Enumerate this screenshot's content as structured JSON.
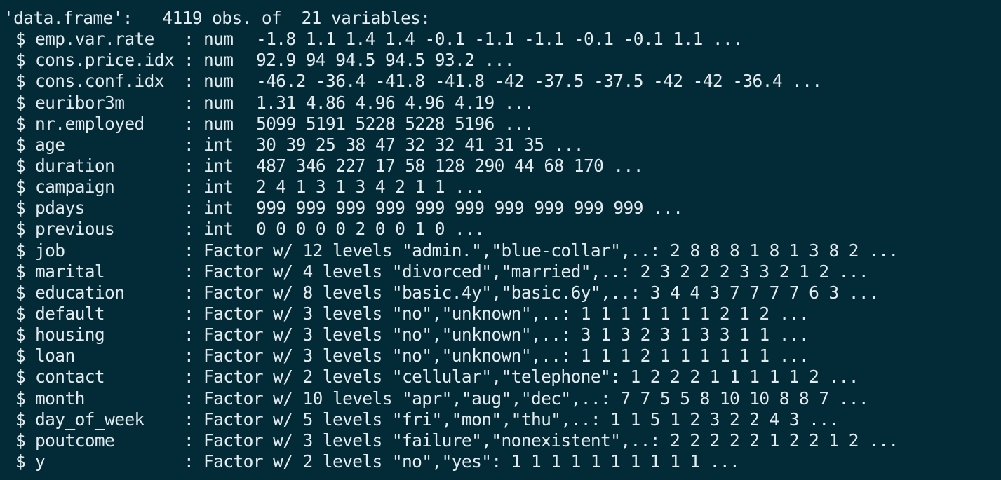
{
  "console": {
    "header": "'data.frame':   4119 obs. of  21 variables:",
    "bullet": "$",
    "colon": ":",
    "rows": [
      {
        "name": "emp.var.rate",
        "type": "num",
        "values": "-1.8 1.1 1.4 1.4 -0.1 -1.1 -1.1 -0.1 -0.1 1.1 ..."
      },
      {
        "name": "cons.price.idx",
        "type": "num",
        "values": "92.9 94 94.5 94.5 93.2 ..."
      },
      {
        "name": "cons.conf.idx",
        "type": "num",
        "values": "-46.2 -36.4 -41.8 -41.8 -42 -37.5 -37.5 -42 -42 -36.4 ..."
      },
      {
        "name": "euribor3m",
        "type": "num",
        "values": "1.31 4.86 4.96 4.96 4.19 ..."
      },
      {
        "name": "nr.employed",
        "type": "num",
        "values": "5099 5191 5228 5228 5196 ..."
      },
      {
        "name": "age",
        "type": "int",
        "values": "30 39 25 38 47 32 32 41 31 35 ..."
      },
      {
        "name": "duration",
        "type": "int",
        "values": "487 346 227 17 58 128 290 44 68 170 ..."
      },
      {
        "name": "campaign",
        "type": "int",
        "values": "2 4 1 3 1 3 4 2 1 1 ..."
      },
      {
        "name": "pdays",
        "type": "int",
        "values": "999 999 999 999 999 999 999 999 999 999 ..."
      },
      {
        "name": "previous",
        "type": "int",
        "values": "0 0 0 0 0 2 0 0 1 0 ..."
      },
      {
        "name": "job",
        "type": "Factor w/ 12 levels",
        "values": "\"admin.\",\"blue-collar\",..: 2 8 8 8 1 8 1 3 8 2 ..."
      },
      {
        "name": "marital",
        "type": "Factor w/ 4 levels",
        "values": "\"divorced\",\"married\",..: 2 3 2 2 2 3 3 2 1 2 ..."
      },
      {
        "name": "education",
        "type": "Factor w/ 8 levels",
        "values": "\"basic.4y\",\"basic.6y\",..: 3 4 4 3 7 7 7 7 6 3 ..."
      },
      {
        "name": "default",
        "type": "Factor w/ 3 levels",
        "values": "\"no\",\"unknown\",..: 1 1 1 1 1 1 1 2 1 2 ..."
      },
      {
        "name": "housing",
        "type": "Factor w/ 3 levels",
        "values": "\"no\",\"unknown\",..: 3 1 3 2 3 1 3 3 1 1 ..."
      },
      {
        "name": "loan",
        "type": "Factor w/ 3 levels",
        "values": "\"no\",\"unknown\",..: 1 1 1 2 1 1 1 1 1 1 ..."
      },
      {
        "name": "contact",
        "type": "Factor w/ 2 levels",
        "values": "\"cellular\",\"telephone\": 1 2 2 2 1 1 1 1 1 2 ..."
      },
      {
        "name": "month",
        "type": "Factor w/ 10 levels",
        "values": "\"apr\",\"aug\",\"dec\",..: 7 7 5 5 8 10 10 8 8 7 ..."
      },
      {
        "name": "day_of_week",
        "type": "Factor w/ 5 levels",
        "values": "\"fri\",\"mon\",\"thu\",..: 1 1 5 1 2 3 2 2 4 3 ..."
      },
      {
        "name": "poutcome",
        "type": "Factor w/ 3 levels",
        "values": "\"failure\",\"nonexistent\",..: 2 2 2 2 2 1 2 2 1 2 ..."
      },
      {
        "name": "y",
        "type": "Factor w/ 2 levels",
        "values": "\"no\",\"yes\": 1 1 1 1 1 1 1 1 1 1 ..."
      }
    ]
  }
}
